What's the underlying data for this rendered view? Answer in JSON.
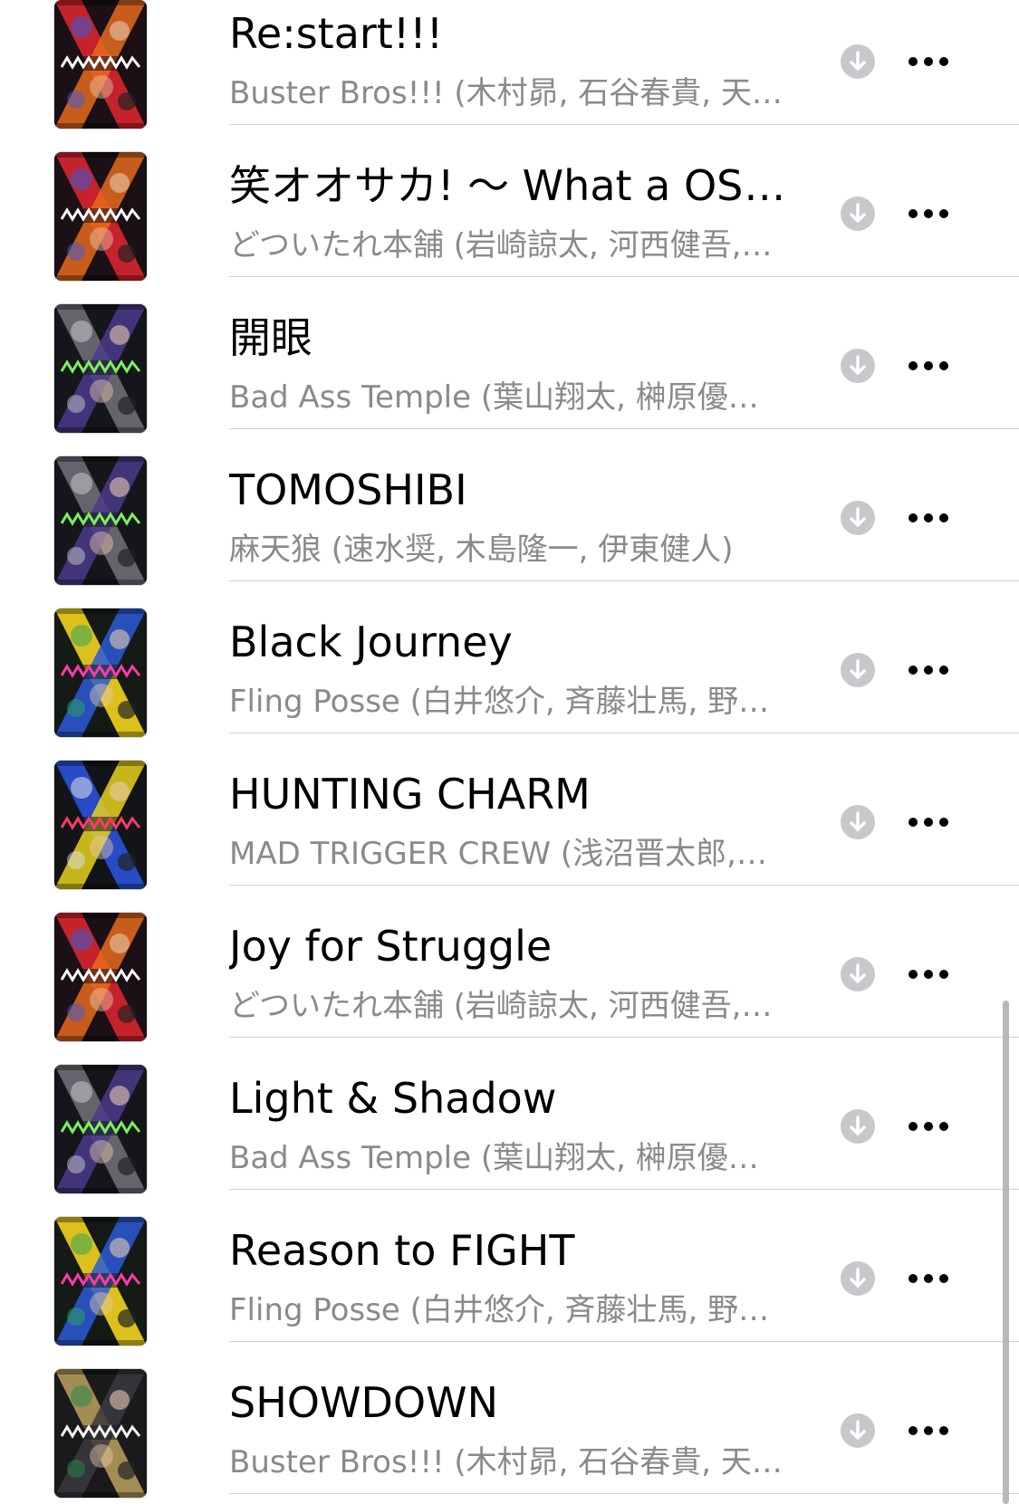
{
  "songs": [
    {
      "title": "Re:start!!!",
      "artist": "Buster Bros!!! (木村昴, 石谷春貴, 天…",
      "cover": "red"
    },
    {
      "title": "笑オオサカ! 〜 What a OSA…",
      "artist": "どついたれ本舗 (岩崎諒太, 河西健吾,…",
      "cover": "red"
    },
    {
      "title": "開眼",
      "artist": "Bad Ass Temple (葉山翔太, 榊原優…",
      "cover": "green"
    },
    {
      "title": "TOMOSHIBI",
      "artist": "麻天狼 (速水奨, 木島隆一, 伊東健人)",
      "cover": "green"
    },
    {
      "title": "Black Journey",
      "artist": "Fling Posse (白井悠介, 斉藤壮馬, 野…",
      "cover": "pink"
    },
    {
      "title": "HUNTING CHARM",
      "artist": "MAD TRIGGER CREW (浅沼晋太郎,…",
      "cover": "blue"
    },
    {
      "title": "Joy for Struggle",
      "artist": "どついたれ本舗 (岩崎諒太, 河西健吾,…",
      "cover": "red"
    },
    {
      "title": "Light & Shadow",
      "artist": "Bad Ass Temple (葉山翔太, 榊原優…",
      "cover": "green"
    },
    {
      "title": "Reason to FIGHT",
      "artist": "Fling Posse (白井悠介, 斉藤壮馬, 野…",
      "cover": "pink"
    },
    {
      "title": "SHOWDOWN",
      "artist": "Buster Bros!!! (木村昴, 石谷春貴, 天…",
      "cover": "gold"
    }
  ],
  "colors": {
    "title": "#000000",
    "subtitle": "#8a8a8e",
    "download_icon_bg": "#c7c7cc",
    "divider": "#d1d1d6"
  },
  "icons": {
    "download": "download-circle-icon",
    "more": "ellipsis-icon"
  }
}
